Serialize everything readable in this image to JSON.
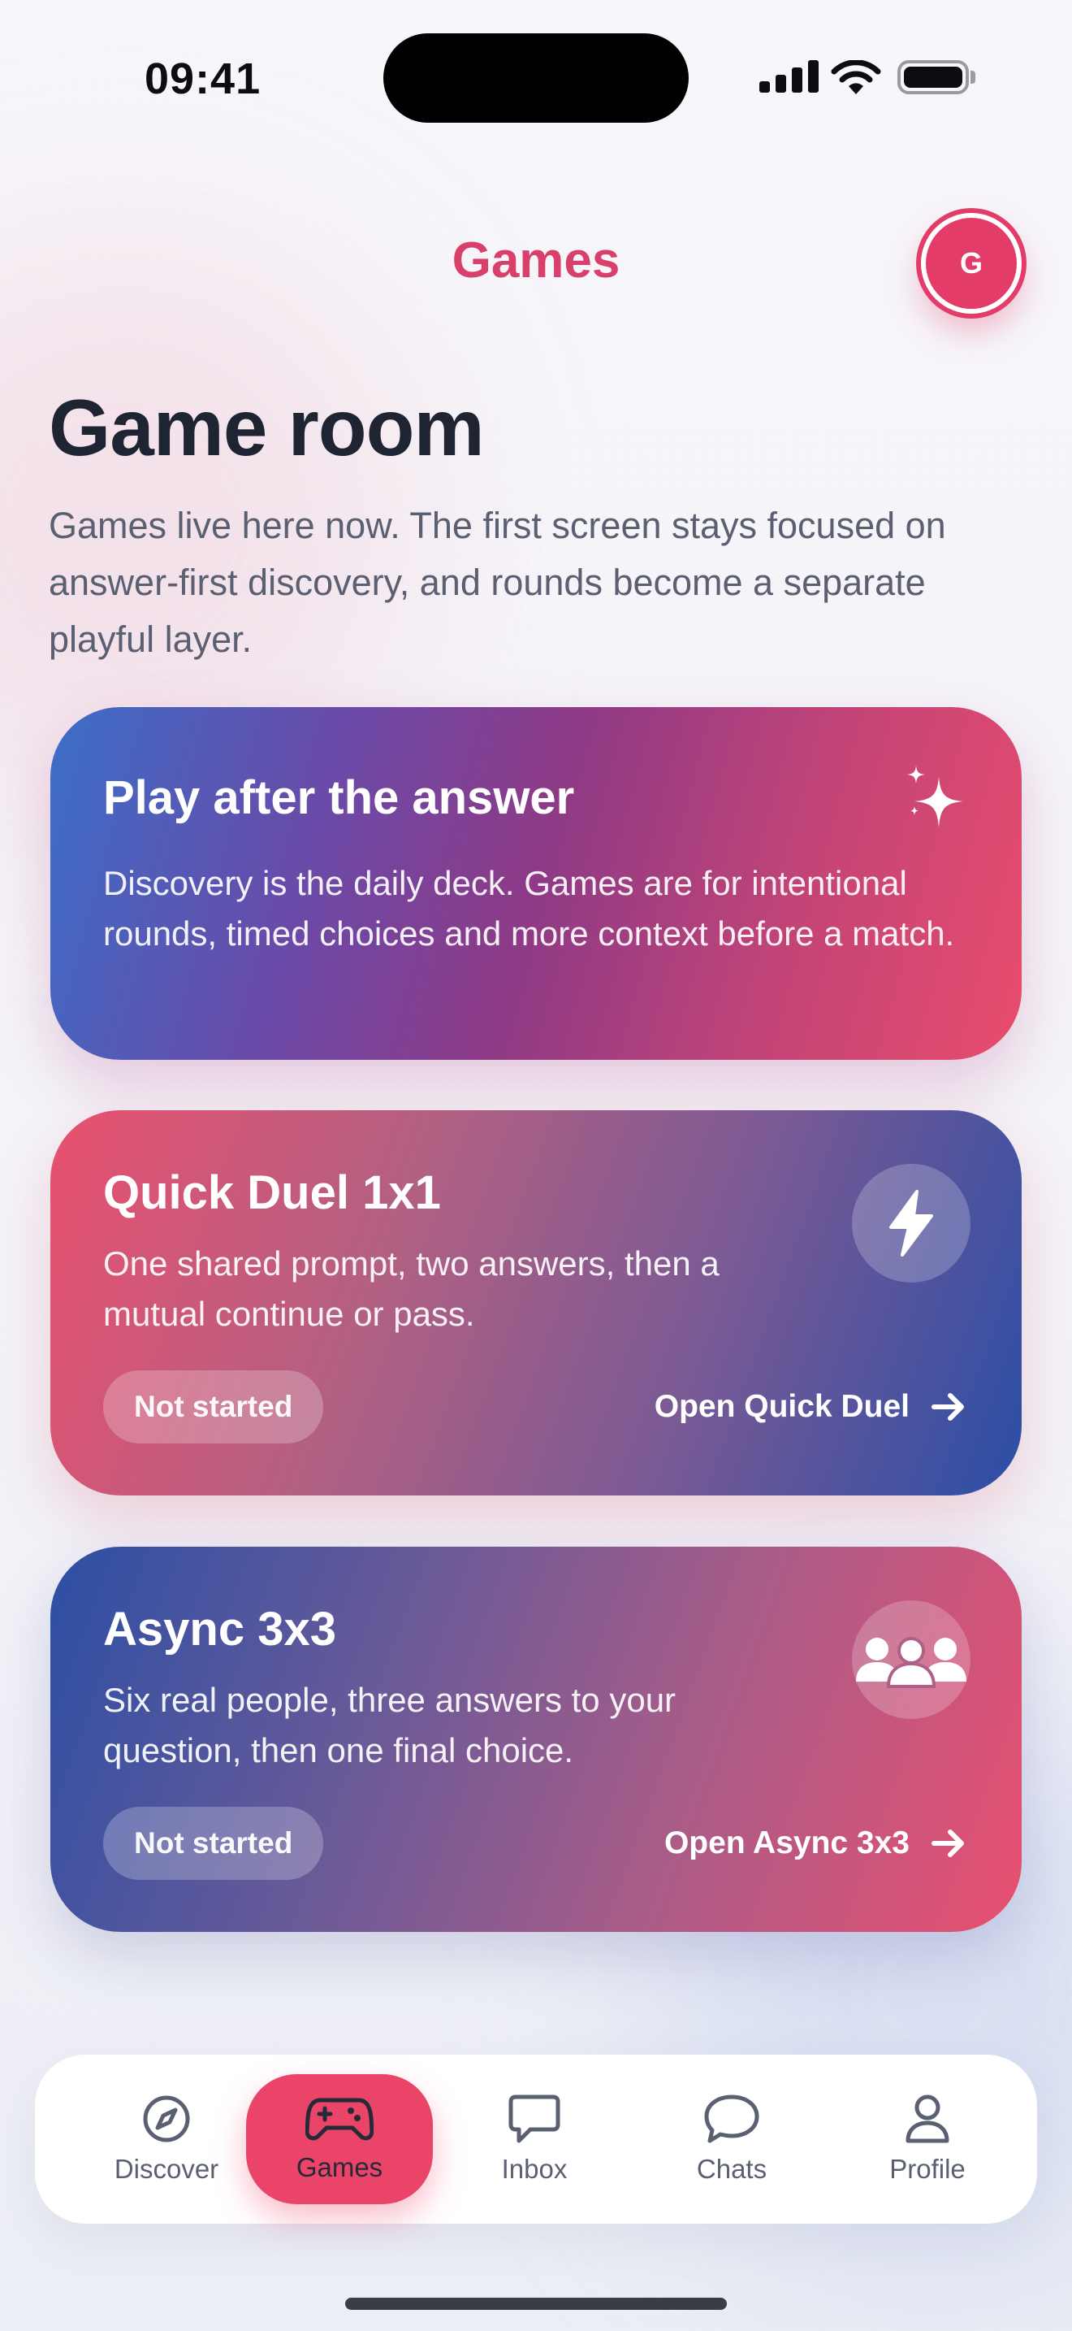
{
  "status_bar": {
    "time": "09:41"
  },
  "header": {
    "title": "Games",
    "avatar_initial": "G"
  },
  "hero": {
    "title": "Game room",
    "description": "Games live here now. The first screen stays focused on answer-first discovery, and rounds become a separate playful layer."
  },
  "intro_card": {
    "title": "Play after the answer",
    "description": "Discovery is the daily deck. Games are for intentional rounds, timed choices and more context before a match.",
    "icon": "sparkles-icon"
  },
  "games": [
    {
      "title": "Quick Duel 1x1",
      "description": "One shared prompt, two answers, then a mutual continue or pass.",
      "status": "Not started",
      "action_label": "Open Quick Duel",
      "icon": "lightning-icon"
    },
    {
      "title": "Async 3x3",
      "description": "Six real people, three answers to your question, then one final choice.",
      "status": "Not started",
      "action_label": "Open Async 3x3",
      "icon": "group-icon"
    }
  ],
  "tab_bar": {
    "active": "Games",
    "items": [
      {
        "label": "Discover",
        "icon": "compass-icon"
      },
      {
        "label": "Games",
        "icon": "gamepad-icon"
      },
      {
        "label": "Inbox",
        "icon": "inbox-icon"
      },
      {
        "label": "Chats",
        "icon": "chat-bubble-icon"
      },
      {
        "label": "Profile",
        "icon": "person-icon"
      }
    ]
  },
  "colors": {
    "accent": "#e33c69",
    "text_primary": "#1f2433",
    "text_secondary": "#5a6072"
  }
}
